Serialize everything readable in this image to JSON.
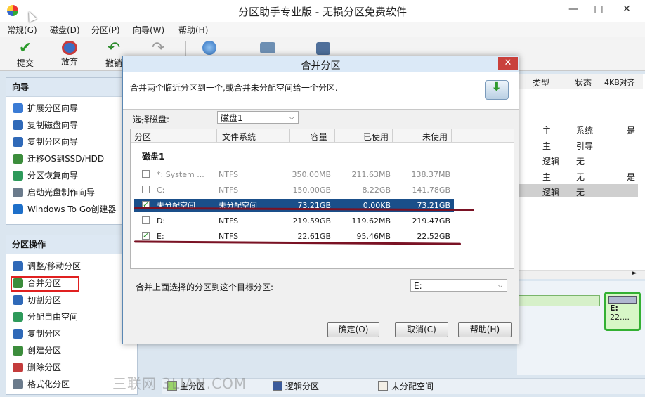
{
  "window": {
    "title": "分区助手专业版 - 无损分区免费软件",
    "controls": [
      "—",
      "□",
      "✕"
    ]
  },
  "menu": [
    {
      "label": "常规(G)"
    },
    {
      "label": "磁盘(D)"
    },
    {
      "label": "分区(P)"
    },
    {
      "label": "向导(W)"
    },
    {
      "label": "帮助(H)"
    }
  ],
  "toolbar": {
    "commit": "提交",
    "discard": "放弃",
    "undo": "撤销"
  },
  "wizard": {
    "title": "向导",
    "items": [
      {
        "label": "扩展分区向导",
        "icon": "extend-partition-icon",
        "color": "#3a7bd5"
      },
      {
        "label": "复制磁盘向导",
        "icon": "copy-disk-icon",
        "color": "#2f69b8"
      },
      {
        "label": "复制分区向导",
        "icon": "copy-partition-icon",
        "color": "#2f69b8"
      },
      {
        "label": "迁移OS到SSD/HDD",
        "icon": "migrate-os-icon",
        "color": "#3c8d3c"
      },
      {
        "label": "分区恢复向导",
        "icon": "recover-partition-icon",
        "color": "#2e9a5b"
      },
      {
        "label": "启动光盘制作向导",
        "icon": "bootable-cd-icon",
        "color": "#6b7b8c"
      },
      {
        "label": "Windows To Go创建器",
        "icon": "windows-to-go-icon",
        "color": "#1d6fc9"
      }
    ]
  },
  "ops": {
    "title": "分区操作",
    "items": [
      {
        "label": "调整/移动分区",
        "icon": "resize-partition-icon",
        "color": "#2f69b8"
      },
      {
        "label": "合并分区",
        "icon": "merge-partition-icon",
        "color": "#3c8d3c"
      },
      {
        "label": "切割分区",
        "icon": "split-partition-icon",
        "color": "#2f69b8"
      },
      {
        "label": "分配自由空间",
        "icon": "allocate-space-icon",
        "color": "#2e9a5b"
      },
      {
        "label": "复制分区",
        "icon": "copy-partition-icon",
        "color": "#2f69b8"
      },
      {
        "label": "创建分区",
        "icon": "create-partition-icon",
        "color": "#3c8d3c"
      },
      {
        "label": "删除分区",
        "icon": "delete-partition-icon",
        "color": "#c43c3c"
      },
      {
        "label": "格式化分区",
        "icon": "format-partition-icon",
        "color": "#6b7b8c"
      }
    ]
  },
  "right_list": {
    "headers": [
      "类型",
      "状态",
      "4KB对齐"
    ],
    "rows": [
      [
        "主",
        "系统",
        "是"
      ],
      [
        "主",
        "引导",
        ""
      ],
      [
        "逻辑",
        "无",
        ""
      ],
      [
        "主",
        "无",
        "是"
      ],
      [
        "逻辑",
        "无",
        ""
      ]
    ]
  },
  "disk_map": {
    "label": "E:",
    "size": "22...."
  },
  "dialog": {
    "title": "合并分区",
    "description": "合并两个临近分区到一个,或合并未分配空间给一个分区.",
    "select_disk_label": "选择磁盘:",
    "select_disk_value": "磁盘1",
    "columns": [
      "分区",
      "文件系统",
      "容量",
      "已使用",
      "未使用"
    ],
    "group": "磁盘1",
    "rows": [
      {
        "name": "*: System ...",
        "fs": "NTFS",
        "capacity": "350.00MB",
        "used": "211.63MB",
        "free": "138.37MB",
        "checked": false,
        "enabled": false
      },
      {
        "name": "C:",
        "fs": "NTFS",
        "capacity": "150.00GB",
        "used": "8.22GB",
        "free": "141.78GB",
        "checked": false,
        "enabled": false
      },
      {
        "name": "未分配空间",
        "fs": "未分配空间",
        "capacity": "73.21GB",
        "used": "0.00KB",
        "free": "73.21GB",
        "checked": true,
        "enabled": true
      },
      {
        "name": "D:",
        "fs": "NTFS",
        "capacity": "219.59GB",
        "used": "119.62MB",
        "free": "219.47GB",
        "checked": false,
        "enabled": true
      },
      {
        "name": "E:",
        "fs": "NTFS",
        "capacity": "22.61GB",
        "used": "95.46MB",
        "free": "22.52GB",
        "checked": true,
        "enabled": true
      }
    ],
    "target_label": "合并上面选择的分区到这个目标分区:",
    "target_value": "E:",
    "ok": "确定(O)",
    "cancel": "取消(C)",
    "help": "帮助(H)"
  },
  "legend": {
    "primary": "主分区",
    "logical": "逻辑分区",
    "unallocated": "未分配空间",
    "watermark": "三联网 3LIAN.COM"
  },
  "colors": {
    "highlight": "#1a4f8a",
    "annotation": "#7a1224",
    "accent_box": "#e02020"
  }
}
